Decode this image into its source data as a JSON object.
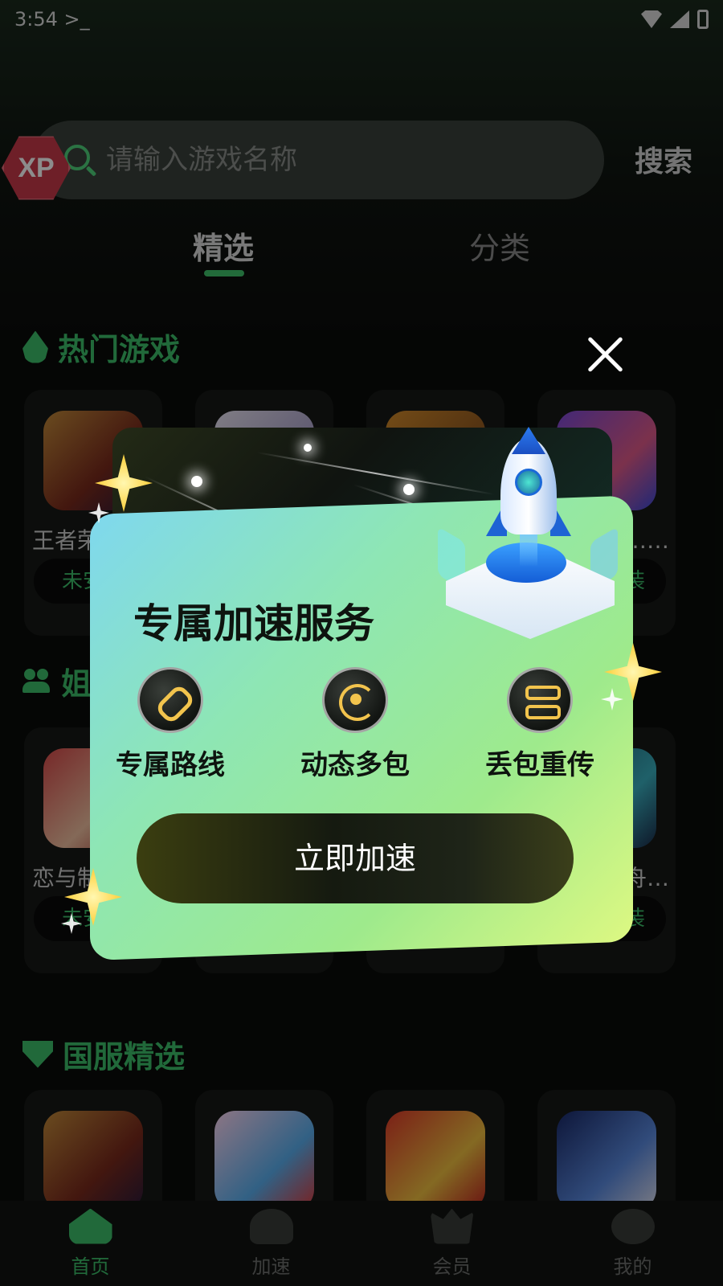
{
  "status_bar": {
    "time": "3:54 >_"
  },
  "badge": {
    "text": "XP"
  },
  "search": {
    "placeholder": "请输入游戏名称",
    "button_label": "搜索"
  },
  "tabs": [
    {
      "label": "精选"
    },
    {
      "label": "分类"
    }
  ],
  "sections": {
    "hot": {
      "title": "热门游戏",
      "games": [
        {
          "name": "王者荣耀",
          "status": "未安装"
        },
        {
          "name": "",
          "status": ""
        },
        {
          "name": "",
          "status": ""
        },
        {
          "name": "…酷…",
          "status": "安装"
        }
      ]
    },
    "second": {
      "title": "姐",
      "games": [
        {
          "name": "恋与制…",
          "status": "未安装"
        },
        {
          "name": "",
          "status": ""
        },
        {
          "name": "",
          "status": ""
        },
        {
          "name": "舟(…",
          "status": "安装"
        }
      ]
    },
    "cn_server": {
      "title": "国服精选"
    }
  },
  "modal": {
    "title": "专属加速服务",
    "features": [
      {
        "label": "专属路线",
        "icon": "link-icon"
      },
      {
        "label": "动态多包",
        "icon": "radar-icon"
      },
      {
        "label": "丢包重传",
        "icon": "route-icon"
      }
    ],
    "cta_label": "立即加速"
  },
  "bottom_nav": [
    {
      "label": "首页",
      "icon": "home-icon",
      "active": true
    },
    {
      "label": "加速",
      "icon": "speed-icon",
      "active": false
    },
    {
      "label": "会员",
      "icon": "vip-icon",
      "active": false
    },
    {
      "label": "我的",
      "icon": "profile-icon",
      "active": false
    }
  ],
  "colors": {
    "accent_green": "#3cc06a",
    "modal_gradient_start": "#7fd8ee",
    "modal_gradient_end": "#ddf882",
    "icon_gold": "#f2c44d"
  }
}
